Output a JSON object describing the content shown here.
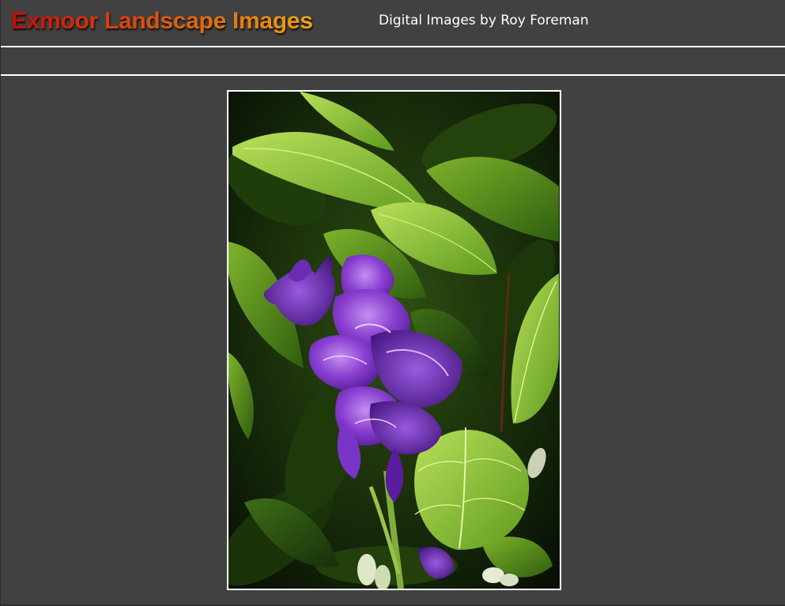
{
  "header": {
    "site_title": "Exmoor Landscape Images",
    "tagline": "Digital Images by Roy Foreman"
  },
  "main": {
    "photo": {
      "subject": "purple-gladiolus-flower-image",
      "icon": "photo-image"
    }
  },
  "colors": {
    "page_background": "#414141",
    "title_gradient_start": "#c40a0a",
    "title_gradient_end": "#f1a214",
    "rule": "#ffffff",
    "tagline": "#ffffff"
  }
}
